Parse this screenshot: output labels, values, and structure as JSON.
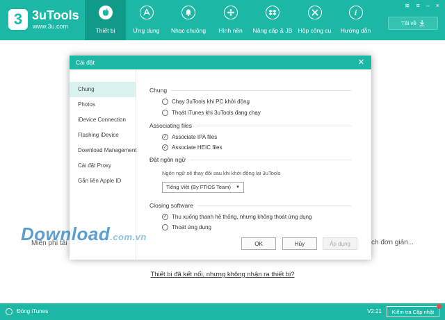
{
  "app": {
    "brand_name": "3uTools",
    "brand_url": "www.3u.com",
    "logo_char": "3"
  },
  "nav": [
    {
      "label": "Thiết bị",
      "icon": "apple-icon",
      "glyph": "",
      "active": true
    },
    {
      "label": "Ứng dụng",
      "icon": "app-store-icon",
      "glyph": "A"
    },
    {
      "label": "Nhạc chuông",
      "icon": "bell-icon",
      "glyph": "🔔"
    },
    {
      "label": "Hình nền",
      "icon": "wallpaper-icon",
      "glyph": "✿"
    },
    {
      "label": "Nâng cấp & JB",
      "icon": "dropbox-icon",
      "glyph": "◆"
    },
    {
      "label": "Hộp công cụ",
      "icon": "tools-icon",
      "glyph": "✕"
    },
    {
      "label": "Hướng dẫn",
      "icon": "info-icon",
      "glyph": "i"
    }
  ],
  "window_controls": {
    "wifi": "≋",
    "menu": "≡",
    "minimize": "–",
    "close": "×"
  },
  "download_button": {
    "label": "Tải về",
    "icon": "download-icon"
  },
  "background": {
    "free_text": "Miễn phí tải",
    "rest_text": "ch đơn giản...",
    "watermark": "Download",
    "watermark_suffix": ".com.vn",
    "not_recognized": "Thiết bị đã kết nối, nhưng không nhận ra thiết bị?",
    "dot_colors": [
      "#86c9ec",
      "#c9c9c9",
      "#b3dc8a",
      "#f5cf7f",
      "#6ba8da",
      "#f18f8f"
    ]
  },
  "dialog": {
    "title": "Cài đặt",
    "sidebar": [
      "Chung",
      "Photos",
      "iDevice Connection",
      "Flashing iDevice",
      "Download Management",
      "Cài đặt Proxy",
      "Gắn liên Apple ID"
    ],
    "sections": {
      "general": {
        "title": "Chung",
        "options": [
          "Chạy 3uTools khi PC khởi động",
          "Thoát iTunes khi 3uTools đang chạy"
        ]
      },
      "associating": {
        "title": "Associating files",
        "options": [
          "Associate IPA files",
          "Associate HEIC files"
        ]
      },
      "language": {
        "title": "Đặt ngôn ngữ",
        "note": "Ngôn ngữ sẽ thay đổi sau khi khởi động lại  3uTools",
        "selected": "Tiếng Việt (By FTiOS Team)"
      },
      "closing": {
        "title": "Closing software",
        "options": [
          "Thu xuống thanh hệ thống, nhưng không thoát ứng dụng",
          "Thoát ứng dụng"
        ]
      }
    },
    "buttons": {
      "ok": "OK",
      "cancel": "Hủy",
      "apply": "Áp dụng"
    }
  },
  "statusbar": {
    "itunes_label": "Đóng iTunes",
    "version": "V2.21",
    "update_label": "Kiểm tra Cập nhật"
  }
}
